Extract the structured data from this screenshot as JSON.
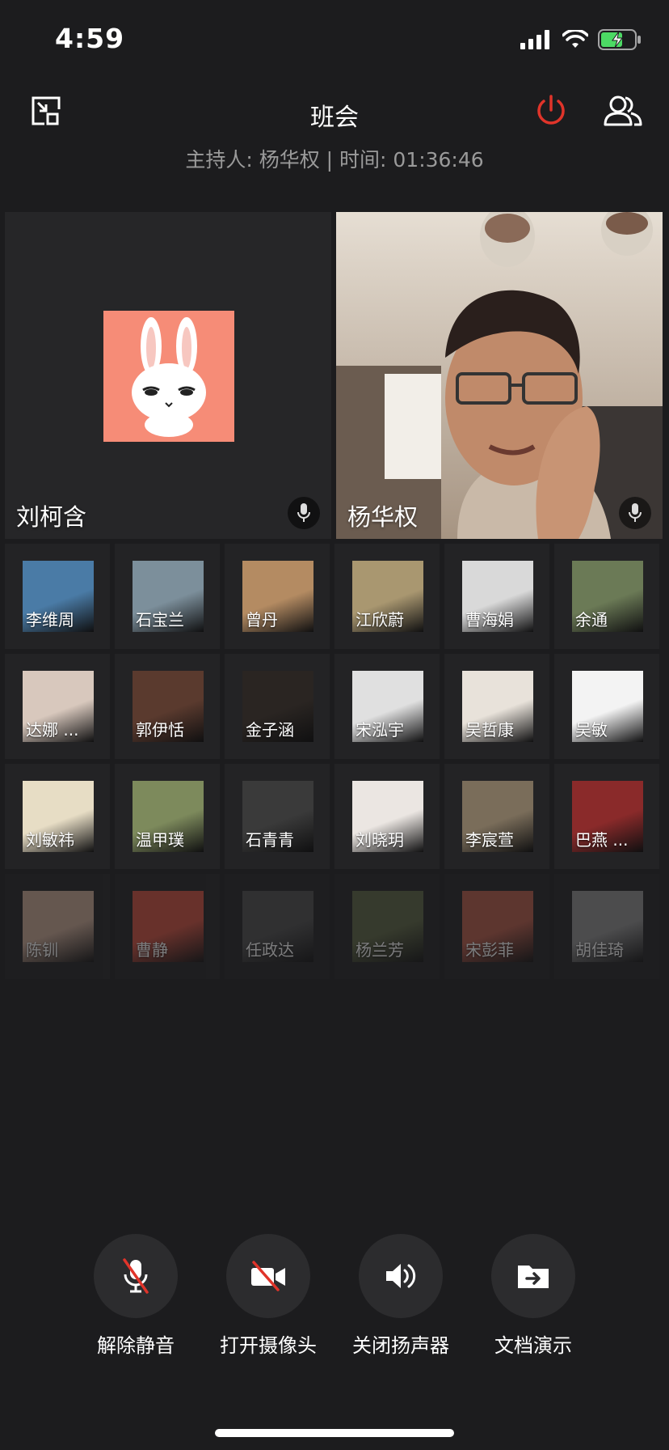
{
  "status_bar": {
    "time": "4:59"
  },
  "header": {
    "title": "班会",
    "subtitle": "主持人: 杨华权 | 时间: 01:36:46",
    "accent_color": "#e0342a"
  },
  "main_videos": [
    {
      "name": "刘柯含",
      "avatar_bg": "#f68c77"
    },
    {
      "name": "杨华权"
    }
  ],
  "participants": [
    [
      {
        "name": "李维周",
        "bg": "#4a7ba6"
      },
      {
        "name": "石宝兰",
        "bg": "#7c8f9b"
      },
      {
        "name": "曾丹",
        "bg": "#b48b62"
      },
      {
        "name": "江欣蔚",
        "bg": "#a99770"
      },
      {
        "name": "曹海娟",
        "bg": "#d9d9d9"
      },
      {
        "name": "余通",
        "bg": "#6b7a56"
      }
    ],
    [
      {
        "name": "达娜 ...",
        "bg": "#d8c8bd"
      },
      {
        "name": "郭伊恬",
        "bg": "#5a3a2e"
      },
      {
        "name": "金子涵",
        "bg": "#2a2522"
      },
      {
        "name": "宋泓宇",
        "bg": "#e0e0e0"
      },
      {
        "name": "吴哲康",
        "bg": "#e8e2da"
      },
      {
        "name": "吴敏",
        "bg": "#f3f3f3"
      }
    ],
    [
      {
        "name": "刘敏祎",
        "bg": "#e7ddc5"
      },
      {
        "name": "温甲璞",
        "bg": "#7d8a5c"
      },
      {
        "name": "石青青",
        "bg": "#3a3a3a"
      },
      {
        "name": "刘晓玥",
        "bg": "#ebe6e2"
      },
      {
        "name": "李宸萱",
        "bg": "#7a6d5a"
      },
      {
        "name": "巴燕 ...",
        "bg": "#8a2a2a"
      }
    ],
    [
      {
        "name": "陈钏",
        "bg": "#caa894"
      },
      {
        "name": "曹静",
        "bg": "#d2503f"
      },
      {
        "name": "任政达",
        "bg": "#4c4c4c"
      },
      {
        "name": "杨兰芳",
        "bg": "#5b6442"
      },
      {
        "name": "宋彭菲",
        "bg": "#b85a48"
      },
      {
        "name": "胡佳琦",
        "bg": "#8f8f8f"
      }
    ]
  ],
  "controls": [
    {
      "label": "解除静音",
      "icon": "mic-muted-icon"
    },
    {
      "label": "打开摄像头",
      "icon": "camera-off-icon"
    },
    {
      "label": "关闭扬声器",
      "icon": "speaker-icon"
    },
    {
      "label": "文档演示",
      "icon": "folder-share-icon"
    }
  ]
}
